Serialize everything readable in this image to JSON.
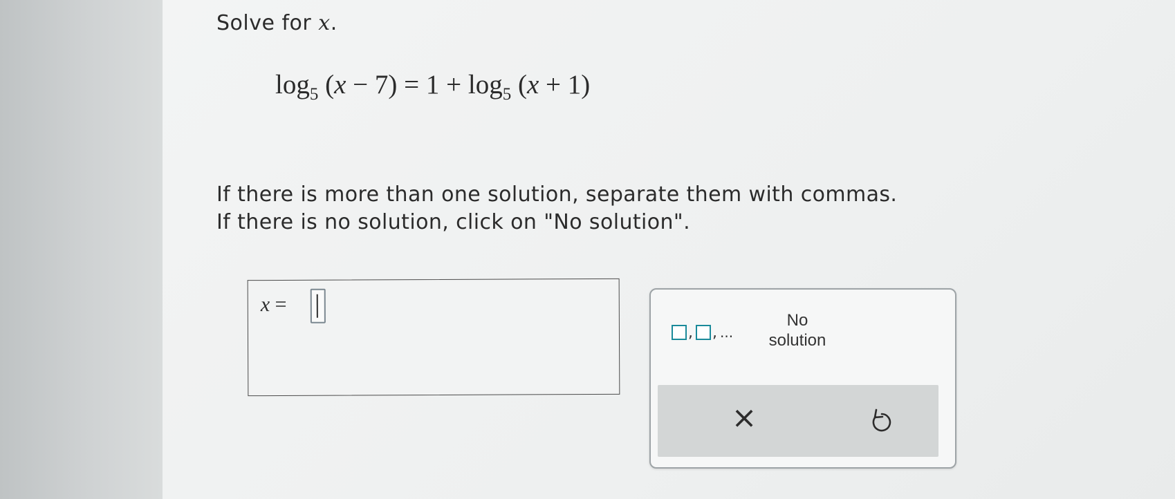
{
  "prompt": {
    "text": "Solve for ",
    "variable": "x",
    "period": "."
  },
  "equation": {
    "log1": "log",
    "base1": "5",
    "arg1_open": " (",
    "arg1_var": "x",
    "arg1_rest": " − 7)",
    "equals_part": " = 1 + ",
    "log2": "log",
    "base2": "5",
    "arg2_open": " (",
    "arg2_var": "x",
    "arg2_rest": " + 1)"
  },
  "instructions": {
    "line1": "If there is more than one solution, separate them with commas.",
    "line2": "If there is no solution, click on \"No solution\"."
  },
  "answer": {
    "variable": "x",
    "equals": " = ",
    "value": ""
  },
  "keypad": {
    "multi_comma": ",",
    "multi_dots": "...",
    "no_solution_line1": "No",
    "no_solution_line2": "solution",
    "clear_symbol": "×",
    "undo_icon": "undo-icon"
  },
  "colors": {
    "accent": "#1a8a9a"
  }
}
